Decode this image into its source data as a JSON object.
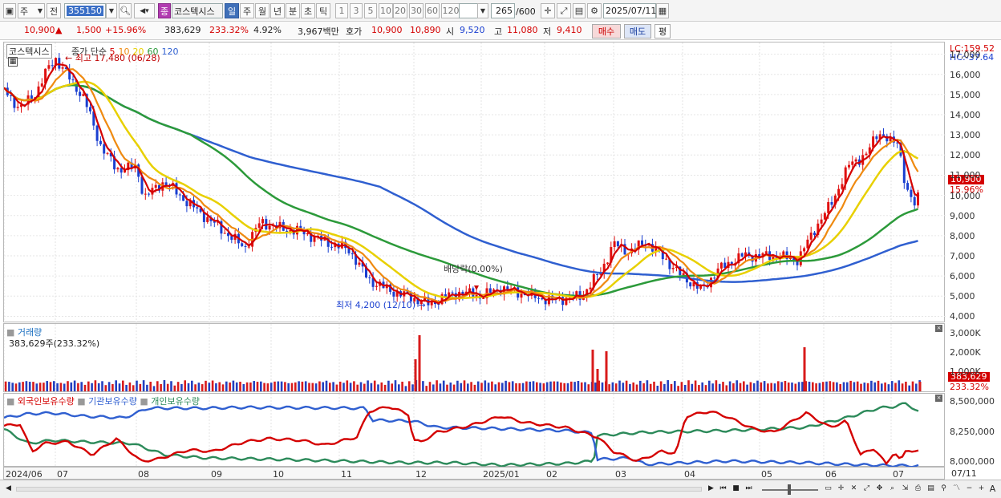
{
  "toolbar": {
    "market": "주",
    "prev": "전",
    "code": "355150",
    "name_badge": "종",
    "name": "코스텍시스",
    "periods": [
      "일",
      "주",
      "월",
      "년",
      "분",
      "초",
      "틱"
    ],
    "intervals": [
      "1",
      "3",
      "5",
      "10",
      "20",
      "30",
      "60",
      "120"
    ],
    "count": "265",
    "count_max": "/600",
    "date": "2025/07/11"
  },
  "quote": {
    "price": "10,900",
    "change": "1,500",
    "change_pct": "+15.96%",
    "volume": "383,629",
    "volume_ratio": "233.32%",
    "turnover": "4.92%",
    "amount": "3,967백만",
    "bid_label": "호가",
    "ask": "10,900",
    "bid": "10,890",
    "open_label": "시",
    "open": "9,520",
    "high_label": "고",
    "high": "11,080",
    "low_label": "저",
    "low": "9,410",
    "buy": "매수",
    "sell": "매도",
    "eval": "평"
  },
  "price_panel": {
    "stock_label": "코스텍시스",
    "ma_label": "종가 단순",
    "ma_periods": [
      "5",
      "10",
      "20",
      "60",
      "120"
    ],
    "ma_colors": [
      "#d40000",
      "#ef8a10",
      "#e8d000",
      "#2c9a3a",
      "#2f5fd0"
    ],
    "high_mark": "최고 17,480 (06/28)",
    "low_mark": "최저 4,200 (12/10)",
    "dividend": "배당락(0.00%)",
    "lc": "LC:159.52",
    "hc": "HC:-37.64",
    "y_ticks": [
      "17,000",
      "16,000",
      "15,000",
      "14,000",
      "13,000",
      "12,000",
      "11,000",
      "10,000",
      "9,000",
      "8,000",
      "7,000",
      "6,000",
      "5,000",
      "4,000"
    ],
    "current": "10,900",
    "current_pct": "15.96%"
  },
  "volume_panel": {
    "title": "거래량",
    "value": "383,629주(233.32%)",
    "y_ticks": [
      "3,000K",
      "2,000K",
      "1,000K"
    ],
    "current": "383,629",
    "current_pct": "233.32%"
  },
  "holding_panel": {
    "foreign": "외국인보유수량",
    "institution": "기관보유수량",
    "individual": "개인보유수량",
    "y_ticks": [
      "8,500,000",
      "8,250,000",
      "8,000,000"
    ]
  },
  "x_axis": [
    "2024/06",
    "07",
    "08",
    "09",
    "10",
    "11",
    "12",
    "2025/01",
    "02",
    "03",
    "04",
    "05",
    "06",
    "07"
  ],
  "x_right": "07/11"
}
